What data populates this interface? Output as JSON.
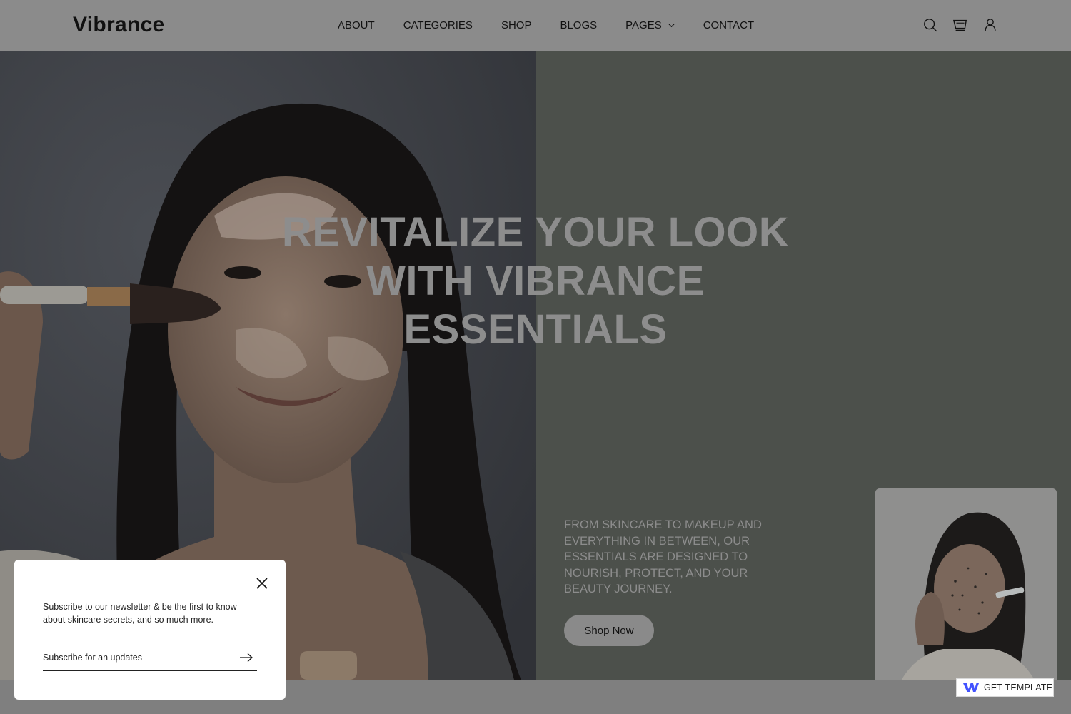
{
  "brand": {
    "logo": "Vibrance"
  },
  "nav": {
    "items": [
      {
        "label": "ABOUT"
      },
      {
        "label": "CATEGORIES"
      },
      {
        "label": "SHOP"
      },
      {
        "label": "BLOGS"
      },
      {
        "label": "PAGES",
        "has_dropdown": true
      },
      {
        "label": "CONTACT"
      }
    ]
  },
  "header_icons": [
    "search-icon",
    "cart-icon",
    "user-icon"
  ],
  "hero": {
    "headline_lines": [
      "REVITALIZE YOUR LOOK",
      "WITH VIBRANCE",
      "ESSENTIALS"
    ],
    "description": "FROM SKINCARE TO MAKEUP AND EVERYTHING IN BETWEEN, OUR ESSENTIALS ARE DESIGNED TO NOURISH, PROTECT, AND YOUR BEAUTY JOURNEY.",
    "cta_label": "Shop Now"
  },
  "newsletter": {
    "text": "Subscribe to our newsletter & be the first to know about skincare secrets, and so much more.",
    "input_placeholder": "Subscribe for an updates"
  },
  "badge": {
    "label": "GET TEMPLATE"
  },
  "colors": {
    "overlay_dim": "#7f7f7f",
    "hero_right_bg": "#4c504b",
    "headline": "#8d8d8d",
    "popup_bg": "#ffffff",
    "badge_logo": "#4353ff"
  }
}
